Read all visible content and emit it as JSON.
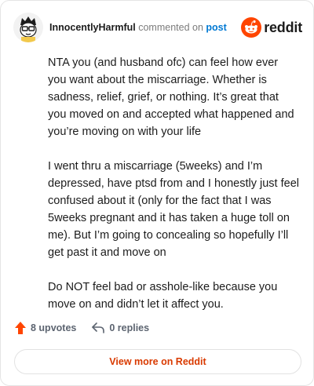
{
  "comment": {
    "username": "InnocentlyHarmful",
    "action_text": "commented on",
    "post_link": "post",
    "paragraphs": [
      "NTA you (and husband ofc) can feel how ever you want about the miscarriage. Whether is sadness, relief, grief, or nothing. It’s great that you moved on and accepted what happened and you’re moving on with your life",
      "I went thru a miscarriage (5weeks) and I’m depressed, have ptsd from and I honestly just feel confused about it (only for the fact that I was 5weeks pregnant and it has taken a huge toll on me). But I’m going to concealing so hopefully I’ll get past it and move on",
      "Do NOT feel bad or asshole-like because you move on and didn’t let it affect you."
    ]
  },
  "brand": {
    "wordmark": "reddit",
    "icon": "reddit-snoo-icon",
    "color": "#ff4500"
  },
  "footer": {
    "upvotes_label": "8 upvotes",
    "replies_label": "0 replies",
    "view_more_label": "View more on Reddit"
  },
  "colors": {
    "accent": "#ff4500",
    "link": "#0079d3",
    "view_more": "#d93a00"
  }
}
